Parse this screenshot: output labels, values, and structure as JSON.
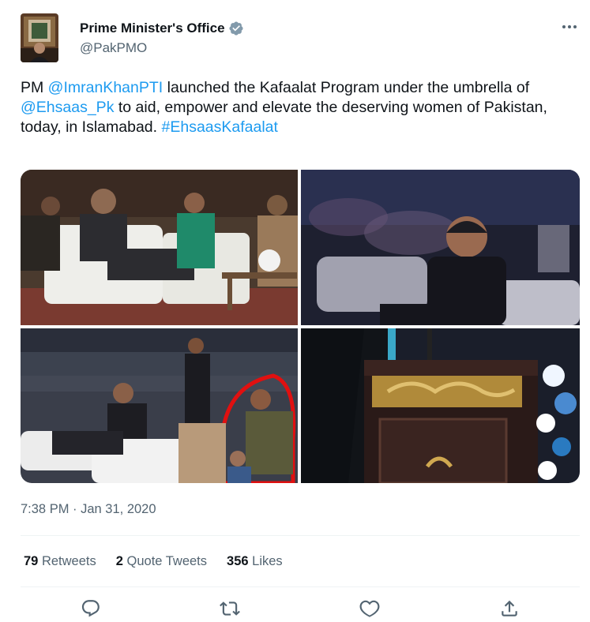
{
  "author": {
    "name": "Prime Minister's Office",
    "handle": "@PakPMO",
    "verified": true,
    "avatar_icon": "profile-photo"
  },
  "tweet": {
    "segments": [
      {
        "text": "PM ",
        "link": false
      },
      {
        "text": "@ImranKhanPTI",
        "link": true
      },
      {
        "text": " launched the Kafaalat Program under the umbrella of ",
        "link": false
      },
      {
        "text": "@Ehsaas_Pk",
        "link": true
      },
      {
        "text": " to aid, empower and elevate the deserving women of Pakistan, today, in Islamabad. ",
        "link": false
      },
      {
        "text": "#EhsaasKafaalat",
        "link": true
      }
    ]
  },
  "media": {
    "photos": [
      {
        "name": "photo-1",
        "icon": "photo"
      },
      {
        "name": "photo-2",
        "icon": "photo"
      },
      {
        "name": "photo-3",
        "icon": "photo"
      },
      {
        "name": "photo-4",
        "icon": "photo"
      }
    ]
  },
  "timestamp": "7:38 PM · Jan 31, 2020",
  "stats": [
    {
      "count": "79",
      "label": "Retweets"
    },
    {
      "count": "2",
      "label": "Quote Tweets"
    },
    {
      "count": "356",
      "label": "Likes"
    }
  ],
  "actions": {
    "reply_icon": "reply-icon",
    "retweet_icon": "retweet-icon",
    "like_icon": "heart-icon",
    "share_icon": "share-icon"
  },
  "colors": {
    "link": "#1d9bf0",
    "text": "#0f1419",
    "secondary": "#536471",
    "divider": "#eff3f4",
    "verified": "#829aab"
  }
}
